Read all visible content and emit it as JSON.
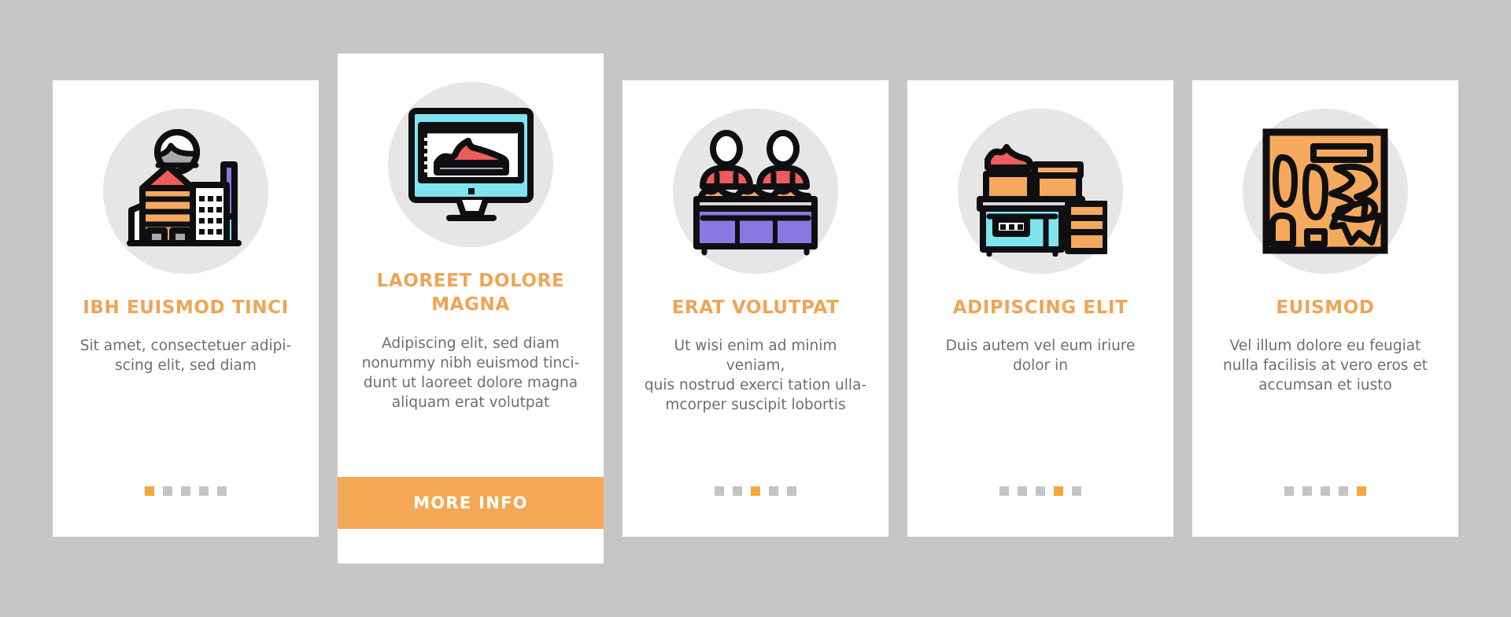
{
  "palette": {
    "background": "#c6c6c6",
    "card_bg": "#ffffff",
    "accent": "#f0a455",
    "cta_bg": "#f4a855",
    "dot_inactive": "#c4c4c4",
    "dot_active": "#f4a63f",
    "icon_circle": "#e6e6e6",
    "body_text": "#6e6e6e",
    "outline": "#0f0f12",
    "orange": "#f4a95f",
    "red": "#ee5c5c",
    "purple": "#8878e0",
    "cyan": "#7fe3f0",
    "gray": "#a8a8a8"
  },
  "cards": [
    {
      "id": "card-1",
      "featured": false,
      "icon": "factory-building-icon",
      "title": "IBH EUISMOD TINCI",
      "description": "Sit amet, consectetuer adipi-\nscing elit, sed diam",
      "dots_total": 5,
      "dots_active_index": 0
    },
    {
      "id": "card-2",
      "featured": true,
      "icon": "monitor-shoe-icon",
      "title": "LAOREET DOLORE MAGNA",
      "description": "Adipiscing elit, sed diam\nnonummy nibh euismod tinci-\ndunt ut laoreet dolore magna\naliquam erat volutpat",
      "cta_label": "MORE INFO"
    },
    {
      "id": "card-3",
      "featured": false,
      "icon": "shop-counter-staff-icon",
      "title": "ERAT VOLUTPAT",
      "description": "Ut wisi enim ad minim veniam,\nquis nostrud exerci tation ulla-\nmcorper suscipit lobortis",
      "dots_total": 5,
      "dots_active_index": 2
    },
    {
      "id": "card-4",
      "featured": false,
      "icon": "shoe-box-shelf-icon",
      "title": "ADIPISCING ELIT",
      "description": "Duis autem vel eum iriure\ndolor in",
      "dots_total": 5,
      "dots_active_index": 3
    },
    {
      "id": "card-5",
      "featured": false,
      "icon": "shoe-pattern-cutout-icon",
      "title": "EUISMOD",
      "description": "Vel illum dolore eu feugiat\nnulla facilisis at vero eros et\naccumsan et iusto",
      "dots_total": 5,
      "dots_active_index": 4
    }
  ]
}
